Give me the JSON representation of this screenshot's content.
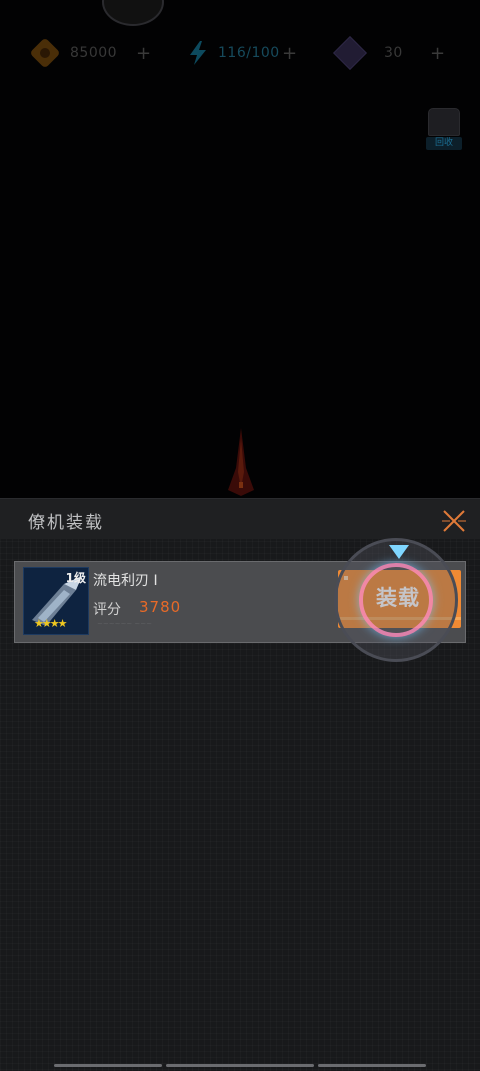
{
  "resources": {
    "gold": "85000",
    "energy": "116/100",
    "gems": "30",
    "plus": "+"
  },
  "storage": {
    "label": "回收"
  },
  "panel": {
    "title": "僚机装载",
    "item": {
      "level": "1级",
      "stars": "★★★★",
      "name": "流电利刃 I",
      "score_label": "评分",
      "score_value": "3780",
      "faint_text": "~~~~~~ ~~~"
    },
    "equip_button": "装载"
  },
  "colors": {
    "accent": "#f08a34",
    "score": "#e86a28",
    "energy": "#1a8ab0",
    "panel_bg": "#18191b"
  },
  "icons": [
    "gold-coin-icon",
    "energy-bolt-icon",
    "gem-icon",
    "storage-icon",
    "close-icon",
    "pointer-arrow-icon"
  ]
}
